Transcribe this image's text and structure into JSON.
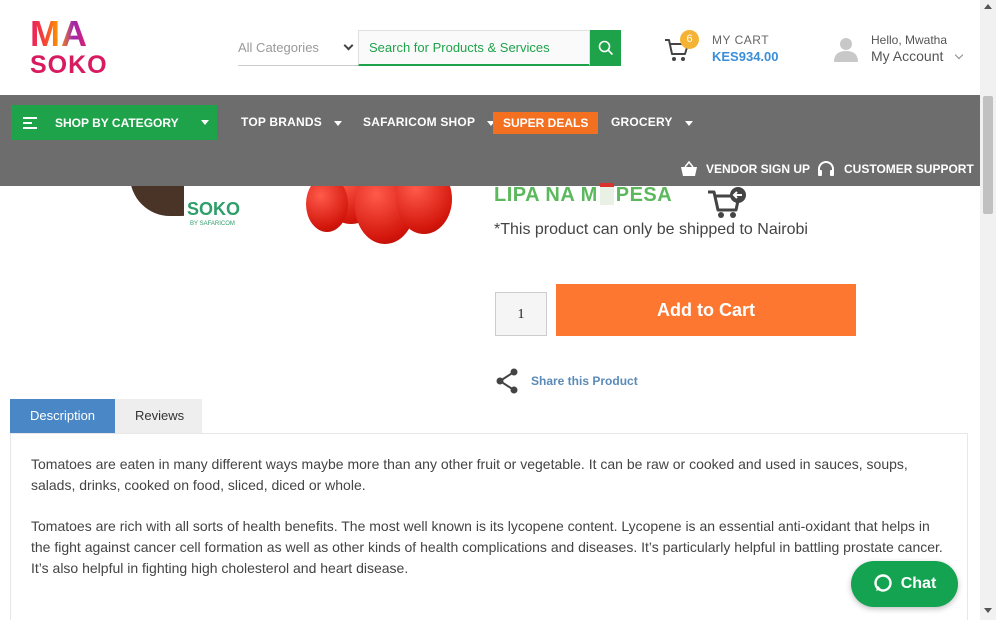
{
  "brand": {
    "logo_top": "MA",
    "logo_bottom": "SOKO"
  },
  "search": {
    "category_selected": "All Categories",
    "placeholder": "Search for Products & Services"
  },
  "cart": {
    "count": "6",
    "title": "MY CART",
    "total": "KES934.00"
  },
  "account": {
    "greeting": "Hello, Mwatha",
    "link": "My Account"
  },
  "nav": {
    "shop_by_category": "SHOP BY CATEGORY",
    "top_brands": "TOP BRANDS",
    "safaricom_shop": "SAFARICOM SHOP",
    "super_deals": "SUPER DEALS",
    "grocery": "GROCERY",
    "vendor_signup": "VENDOR SIGN UP",
    "customer_support": "CUSTOMER SUPPORT"
  },
  "product": {
    "image_logo": "SOKO",
    "image_logo_sub": "BY SAFARICOM",
    "payment_left": "LIPA NA M",
    "payment_right": "PESA",
    "ship_note": "*This product can only be shipped to Nairobi",
    "quantity": "1",
    "add_to_cart": "Add to Cart",
    "share": "Share this Product"
  },
  "tabs": [
    {
      "label": "Description"
    },
    {
      "label": "Reviews"
    }
  ],
  "description": [
    "Tomatoes are eaten in many different ways maybe more than any other fruit or vegetable. It can be raw or cooked and used in sauces, soups, salads, drinks, cooked on food, sliced, diced or whole.",
    "Tomatoes are rich with all sorts of health benefits. The most well known is its lycopene content. Lycopene is an essential anti-oxidant that helps in the fight against cancer cell formation as well as other kinds of health complications and diseases. It’s particularly helpful in battling prostate cancer. It’s also helpful in fighting high cholesterol and heart disease."
  ],
  "chat": {
    "label": "Chat"
  },
  "colors": {
    "green": "#1fa34a",
    "orange": "#fd7731",
    "nav_gray": "#6d6d6d",
    "tab_blue": "#4a87c6"
  }
}
